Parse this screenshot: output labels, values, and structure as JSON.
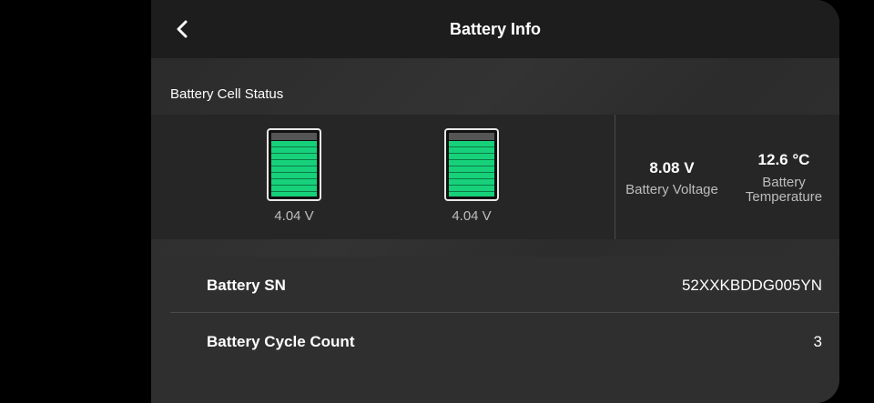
{
  "header": {
    "title": "Battery Info",
    "back_icon": "chevron-left-icon"
  },
  "cell_status": {
    "label": "Battery Cell Status",
    "cells": [
      {
        "voltage": "4.04 V",
        "level": 0.85
      },
      {
        "voltage": "4.04 V",
        "level": 0.85
      }
    ],
    "voltage": {
      "value": "8.08 V",
      "label": "Battery Voltage"
    },
    "temperature": {
      "value": "12.6 °C",
      "label_line1": "Battery",
      "label_line2": "Temperature"
    }
  },
  "info": {
    "rows": [
      {
        "label": "Battery SN",
        "value": "52XXKBDDG005YN"
      },
      {
        "label": "Battery Cycle Count",
        "value": "3"
      }
    ]
  },
  "colors": {
    "cell_green": "#17d17a",
    "panel": "#2b2b2b",
    "header": "#1d1d1d"
  }
}
